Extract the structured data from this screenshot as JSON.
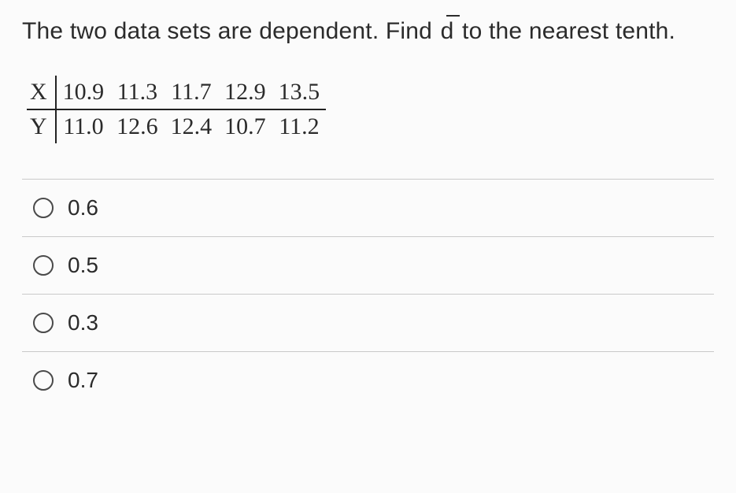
{
  "question": {
    "prefix": "The two data sets are dependent. Find ",
    "symbol": "d",
    "suffix": " to the nearest tenth."
  },
  "table": {
    "rows": [
      {
        "label": "X",
        "values": [
          "10.9",
          "11.3",
          "11.7",
          "12.9",
          "13.5"
        ]
      },
      {
        "label": "Y",
        "values": [
          "11.0",
          "12.6",
          "12.4",
          "10.7",
          "11.2"
        ]
      }
    ]
  },
  "options": [
    {
      "label": "0.6"
    },
    {
      "label": "0.5"
    },
    {
      "label": "0.3"
    },
    {
      "label": "0.7"
    }
  ]
}
